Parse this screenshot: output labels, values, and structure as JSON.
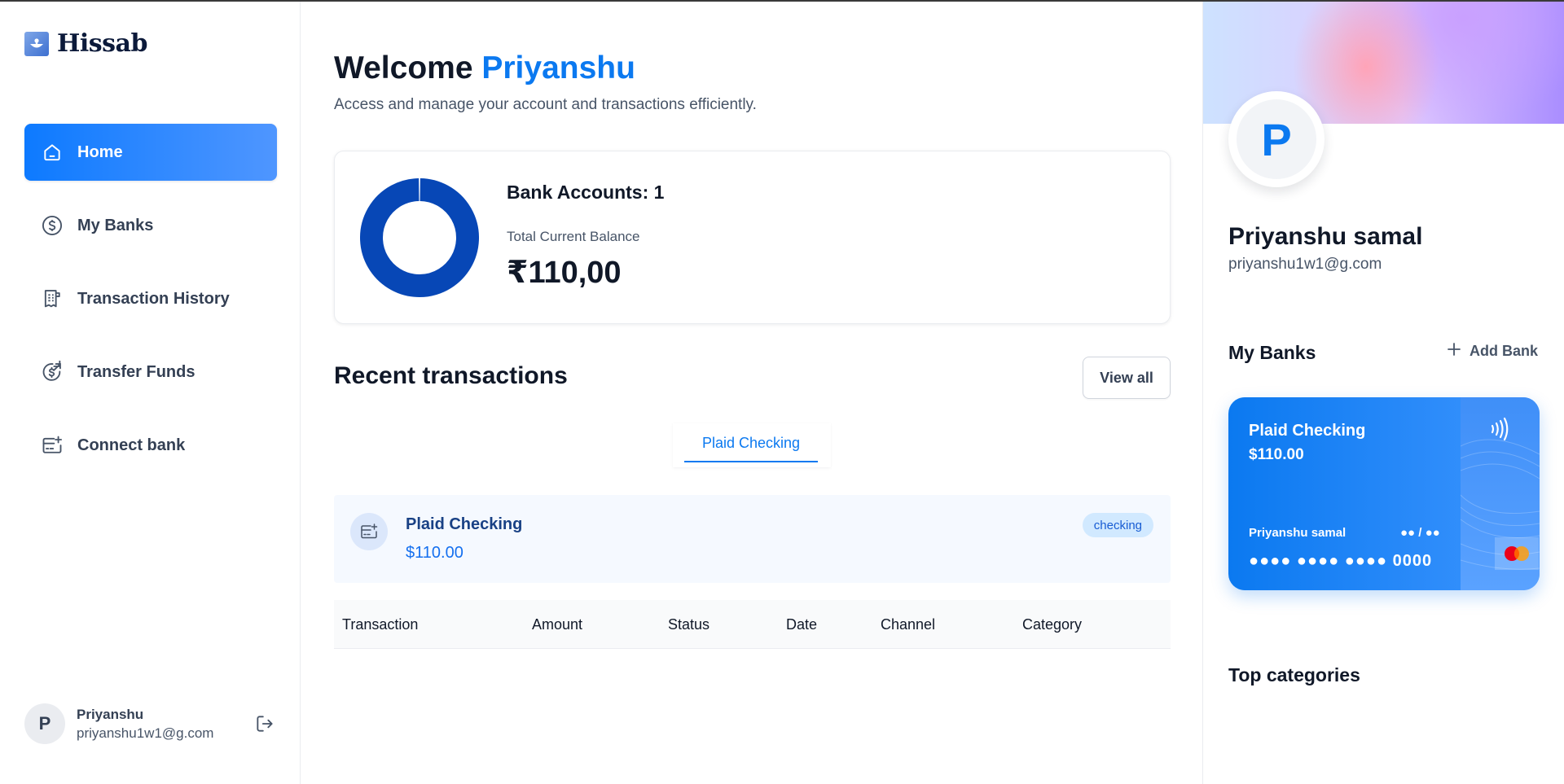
{
  "app": {
    "name": "Hissab"
  },
  "sidebar": {
    "items": [
      {
        "label": "Home",
        "icon": "home-icon",
        "active": true
      },
      {
        "label": "My Banks",
        "icon": "dollar-circle-icon",
        "active": false
      },
      {
        "label": "Transaction History",
        "icon": "receipt-icon",
        "active": false
      },
      {
        "label": "Transfer Funds",
        "icon": "money-send-icon",
        "active": false
      },
      {
        "label": "Connect bank",
        "icon": "card-add-icon",
        "active": false
      }
    ],
    "user": {
      "initial": "P",
      "name": "Priyanshu",
      "email": "priyanshu1w1@g.com"
    }
  },
  "header": {
    "welcome": "Welcome",
    "user_name": "Priyanshu",
    "subtitle": "Access and manage your account and transactions efficiently."
  },
  "balance": {
    "accounts_label": "Bank Accounts: 1",
    "total_label": "Total Current Balance",
    "total_value": "₹110,00"
  },
  "chart_data": {
    "type": "pie",
    "categories": [
      "Plaid Checking"
    ],
    "values": [
      110
    ],
    "donut": true,
    "colors": [
      "#0747b6"
    ]
  },
  "transactions": {
    "title": "Recent transactions",
    "view_all": "View all",
    "tabs": [
      {
        "label": "Plaid Checking",
        "active": true
      }
    ],
    "account": {
      "name": "Plaid Checking",
      "amount": "$110.00",
      "type": "checking"
    },
    "columns": [
      "Transaction",
      "Amount",
      "Status",
      "Date",
      "Channel",
      "Category"
    ]
  },
  "profile": {
    "initial": "P",
    "name": "Priyanshu samal",
    "email": "priyanshu1w1@g.com"
  },
  "my_banks": {
    "title": "My Banks",
    "add_label": "Add Bank",
    "card": {
      "bank": "Plaid Checking",
      "balance": "$110.00",
      "holder": "Priyanshu samal",
      "expiry": "●● / ●●",
      "number": "●●●● ●●●● ●●●● 0000"
    }
  },
  "top_categories": {
    "title": "Top categories"
  },
  "colors": {
    "accent": "#0b79f0",
    "donut": "#0747b6",
    "badge_bg": "#d1e9ff",
    "account_row_bg": "#f5f9ff"
  }
}
